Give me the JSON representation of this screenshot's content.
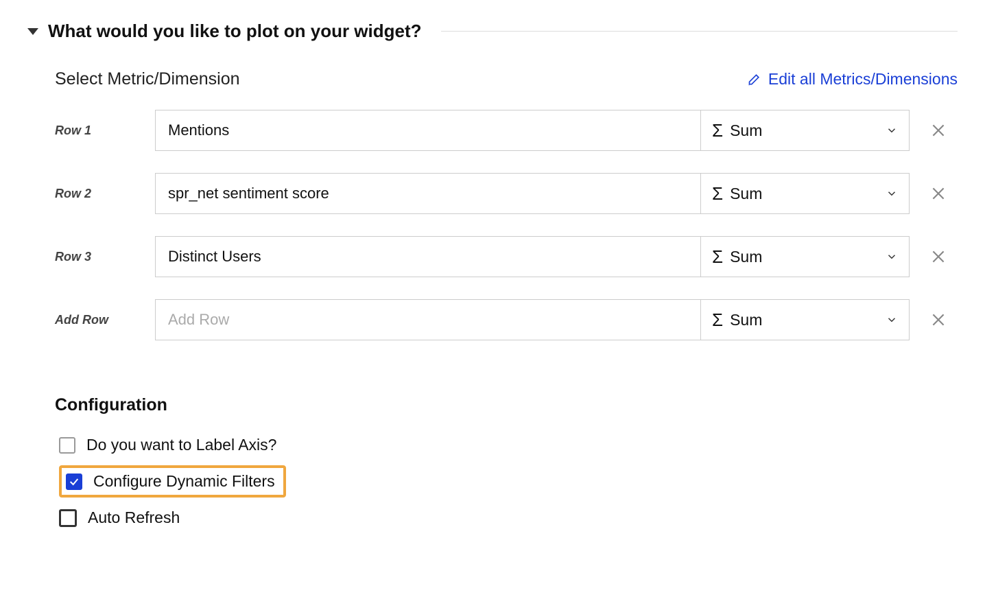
{
  "section": {
    "title": "What would you like to plot on your widget?"
  },
  "metrics": {
    "label": "Select Metric/Dimension",
    "edit_link": "Edit all Metrics/Dimensions",
    "sigma": "Σ",
    "rows": [
      {
        "label": "Row 1",
        "metric": "Mentions",
        "agg": "Sum",
        "placeholder": ""
      },
      {
        "label": "Row 2",
        "metric": "spr_net sentiment score",
        "agg": "Sum",
        "placeholder": ""
      },
      {
        "label": "Row 3",
        "metric": "Distinct Users",
        "agg": "Sum",
        "placeholder": ""
      },
      {
        "label": "Add Row",
        "metric": "",
        "agg": "Sum",
        "placeholder": "Add Row"
      }
    ]
  },
  "config": {
    "heading": "Configuration",
    "options": [
      {
        "label": "Do you want to Label Axis?",
        "checked": false,
        "highlight": false,
        "thick": false
      },
      {
        "label": "Configure Dynamic Filters",
        "checked": true,
        "highlight": true,
        "thick": false
      },
      {
        "label": "Auto Refresh",
        "checked": false,
        "highlight": false,
        "thick": true
      }
    ]
  }
}
